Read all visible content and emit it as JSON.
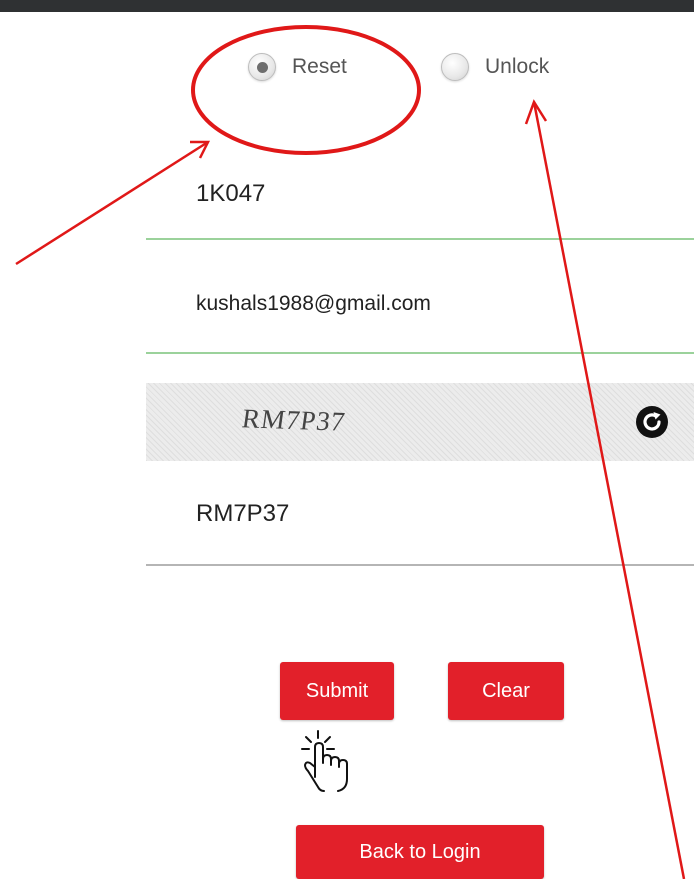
{
  "radio": {
    "reset_label": "Reset",
    "unlock_label": "Unlock",
    "selected": "Reset"
  },
  "form": {
    "user_id_value": "1K047",
    "email_value": "kushals1988@gmail.com",
    "captcha_image_text": "RM7P37",
    "captcha_input_value": "RM7P37"
  },
  "buttons": {
    "submit_label": "Submit",
    "clear_label": "Clear",
    "back_label": "Back to Login"
  },
  "icons": {
    "refresh": "refresh-icon",
    "hand": "hand-pointer-icon"
  },
  "colors": {
    "accent": "#e2202a",
    "annotation": "#e01818",
    "field_underline_valid": "#9bd29b",
    "field_underline_default": "#b5b5b5"
  }
}
